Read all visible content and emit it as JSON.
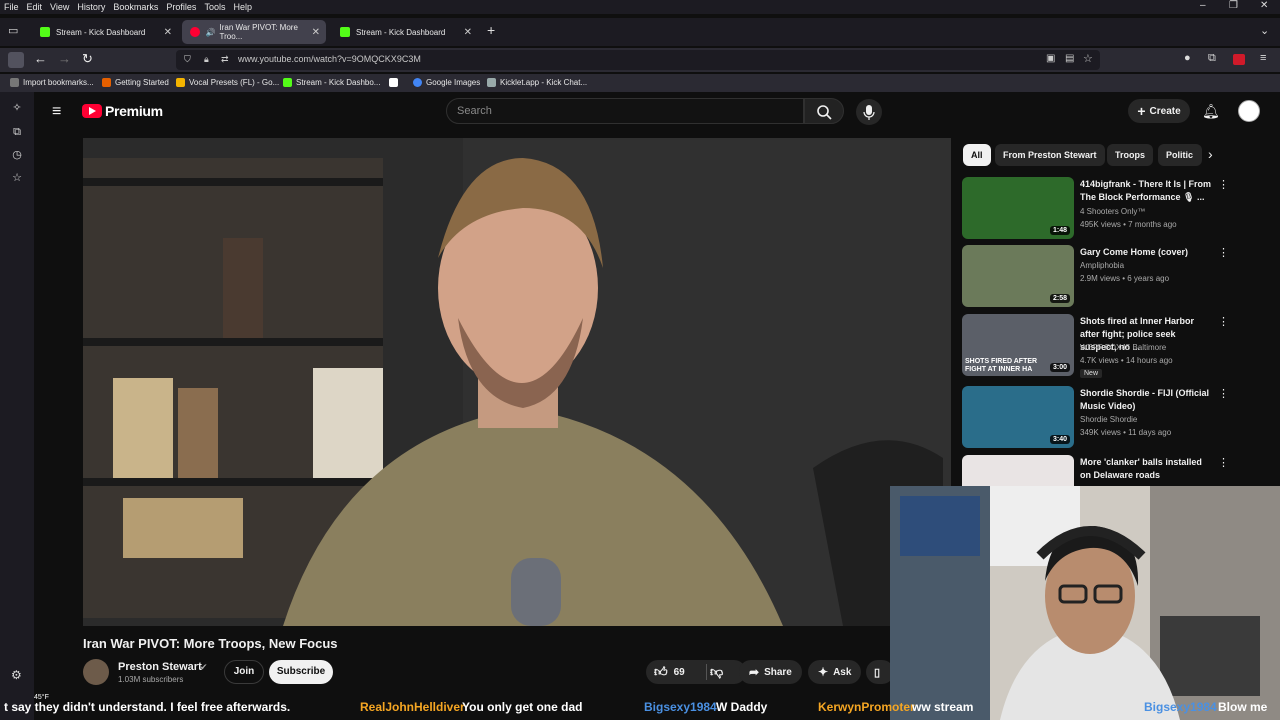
{
  "menubar": [
    "File",
    "Edit",
    "View",
    "History",
    "Bookmarks",
    "Profiles",
    "Tools",
    "Help"
  ],
  "tabs": [
    {
      "label": "Stream - Kick Dashboard",
      "active": false
    },
    {
      "label": "Iran War PIVOT: More Troo...",
      "active": true
    },
    {
      "label": "Stream - Kick Dashboard",
      "active": false
    }
  ],
  "url": "www.youtube.com/watch?v=9OMQCKX9C3M",
  "bookmarks": [
    "Import bookmarks...",
    "Getting Started",
    "Vocal Presets (FL) - Go...",
    "Stream - Kick Dashbo...",
    "Google Images",
    "Kicklet.app - Kick Chat..."
  ],
  "yt": {
    "logo": "Premium",
    "search_placeholder": "Search",
    "create": "Create",
    "chips": [
      "All",
      "From Preston Stewart",
      "Troops",
      "Politic"
    ]
  },
  "video": {
    "title": "Iran War PIVOT: More Troops, New Focus",
    "channel": "Preston Stewart",
    "subs": "1.03M subscribers",
    "join": "Join",
    "subscribe": "Subscribe",
    "likes": "69",
    "share": "Share",
    "ask": "Ask"
  },
  "recs": [
    {
      "title": "414bigfrank - There It Is | From The Block Performance 🎙 ...",
      "channel": "4 Shooters Only™",
      "meta": "495K views • 7 months ago",
      "duration": "1:48",
      "color": "#2d6a2a"
    },
    {
      "title": "Gary Come Home (cover)",
      "channel": "Ampliphobia",
      "meta": "2.9M views • 6 years ago",
      "duration": "2:58",
      "color": "#6b7a5a"
    },
    {
      "title": "Shots fired at Inner Harbor after fight; police seek suspect, no ...",
      "channel": "WBFF FOX45 Baltimore",
      "meta": "4.7K views • 14 hours ago",
      "duration": "3:00",
      "color": "#5b5f68",
      "badge": "New",
      "overlay": "SHOTS FIRED AFTER FIGHT AT INNER HA"
    },
    {
      "title": "Shordie Shordie - FIJI (Official Music Video)",
      "channel": "Shordie Shordie",
      "meta": "349K views • 11 days ago",
      "duration": "3:40",
      "color": "#2a6d8a"
    },
    {
      "title": "More 'clanker' balls installed on Delaware roads",
      "channel": "",
      "meta": "",
      "duration": "",
      "color": "#e9e4e4"
    }
  ],
  "weather": "45°F",
  "chat": [
    {
      "text": "t say they didn't understand. I feel free afterwards.",
      "color": "#ffffff"
    },
    {
      "text": "RealJohnHelldiver",
      "color": "#f5a623"
    },
    {
      "text": "You only get one dad",
      "color": "#ffffff"
    },
    {
      "text": "Bigsexy1984",
      "color": "#4a90e2"
    },
    {
      "text": "W Daddy",
      "color": "#ffffff"
    },
    {
      "text": "KerwynPromoter",
      "color": "#f5a623"
    },
    {
      "text": "ww stream",
      "color": "#ffffff"
    },
    {
      "text": "Bigsexy1984",
      "color": "#4a90e2"
    },
    {
      "text": "Blow me",
      "color": "#ffffff"
    }
  ]
}
